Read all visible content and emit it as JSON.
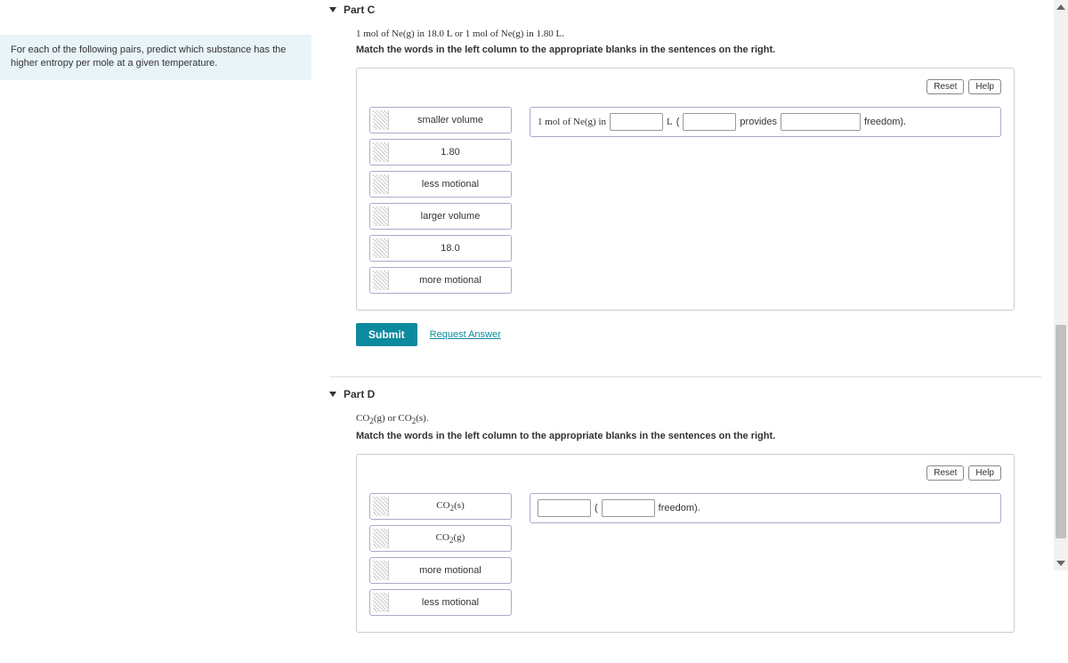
{
  "left_panel": {
    "text": "For each of the following pairs, predict which substance has the higher entropy per mole at a given temperature."
  },
  "partC": {
    "title": "Part C",
    "prompt_prefix": "1 mol",
    "prompt_mid1": " of ",
    "prompt_ne1": "Ne(g)",
    "prompt_mid2": " in 18.0 ",
    "prompt_L1": "L",
    "prompt_mid3": " or 1 ",
    "prompt_mol2": "mol",
    "prompt_mid4": " of ",
    "prompt_ne2": "Ne(g)",
    "prompt_mid5": " in 1.80 ",
    "prompt_L2": "L",
    "prompt_end": ".",
    "instruction": "Match the words in the left column to the appropriate blanks in the sentences on the right.",
    "reset": "Reset",
    "help": "Help",
    "tiles": [
      "smaller volume",
      "1.80",
      "less motional",
      "larger volume",
      "18.0",
      "more motional"
    ],
    "sentence": {
      "s1a": "1 ",
      "s1b": "mol",
      "s1c": " of ",
      "s1d": "Ne(g)",
      "s1e": " in",
      "s2": "L",
      "s3": "(",
      "s4": " provides ",
      "s5": " freedom)."
    },
    "submit": "Submit",
    "request": "Request Answer"
  },
  "partD": {
    "title": "Part D",
    "prompt_a": "CO",
    "prompt_b": "2",
    "prompt_c": "(g)",
    "prompt_d": " or ",
    "prompt_e": "CO",
    "prompt_f": "2",
    "prompt_g": "(s)",
    "prompt_h": ".",
    "instruction": "Match the words in the left column to the appropriate blanks in the sentences on the right.",
    "reset": "Reset",
    "help": "Help",
    "tiles": [
      {
        "pre": "CO",
        "sub": "2",
        "suf": "(s)"
      },
      {
        "pre": "CO",
        "sub": "2",
        "suf": "(g)"
      },
      {
        "plain": "more motional"
      },
      {
        "plain": "less motional"
      }
    ],
    "sentence": {
      "s1": "(",
      "s2": " freedom)."
    }
  }
}
